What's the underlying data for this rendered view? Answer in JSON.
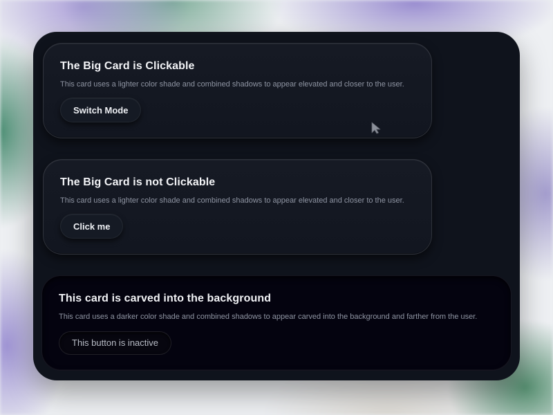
{
  "cards": [
    {
      "title": "The Big Card is Clickable",
      "description": "This card uses a lighter color shade and combined shadows to appear elevated and closer to the user.",
      "button_label": "Switch Mode"
    },
    {
      "title": "The Big Card is not Clickable",
      "description": "This card uses a lighter color shade and combined shadows to appear elevated and closer to the user.",
      "button_label": "Click me"
    },
    {
      "title": "This card is carved into the background",
      "description": "This card uses a darker color shade and combined shadows to appear carved into the background and farther from the user.",
      "button_label": "This button is inactive"
    }
  ],
  "colors": {
    "panel": "#0f131c",
    "raised_card": "#161a24",
    "carved_card": "#04030f",
    "title_text": "#f2f3f6",
    "description_text": "#8f95a3"
  },
  "icons": {
    "cursor": "mouse-pointer-icon"
  }
}
